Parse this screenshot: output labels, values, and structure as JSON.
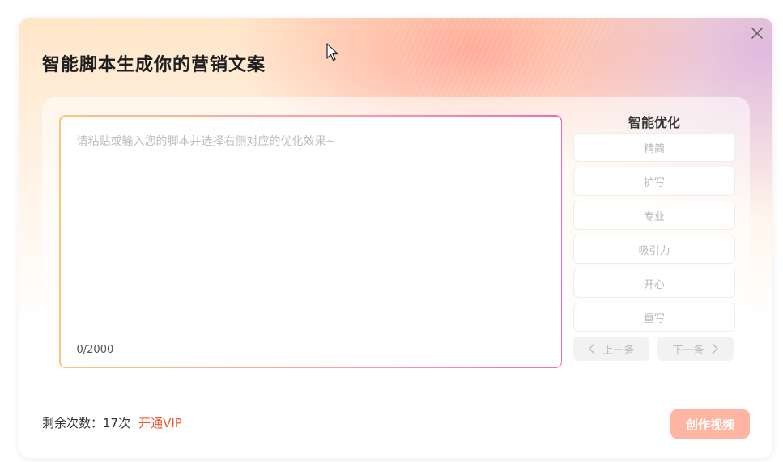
{
  "dialog": {
    "title": "智能脚本生成你的营销文案"
  },
  "editor": {
    "placeholder": "请粘贴或输入您的脚本并选择右侧对应的优化效果~",
    "counter": "0/2000"
  },
  "optimize": {
    "title": "智能优化",
    "options": [
      {
        "label": "精简"
      },
      {
        "label": "扩写"
      },
      {
        "label": "专业"
      },
      {
        "label": "吸引力"
      },
      {
        "label": "开心"
      },
      {
        "label": "重写"
      }
    ],
    "prev_label": "上一条",
    "next_label": "下一条"
  },
  "footer": {
    "remaining_label": "剩余次数：",
    "remaining_count": "17次",
    "vip_link": "开通VIP",
    "create_button": "创作视频"
  },
  "colors": {
    "accent": "#f0562b",
    "create_button_bg": "#ffb5a2",
    "editor_border_start": "#ffc37a",
    "editor_border_end": "#f36bb1"
  },
  "icons": {
    "close": "close-icon",
    "prev": "chevron-left-icon",
    "next": "chevron-right-icon",
    "cursor": "mouse-pointer-icon"
  }
}
